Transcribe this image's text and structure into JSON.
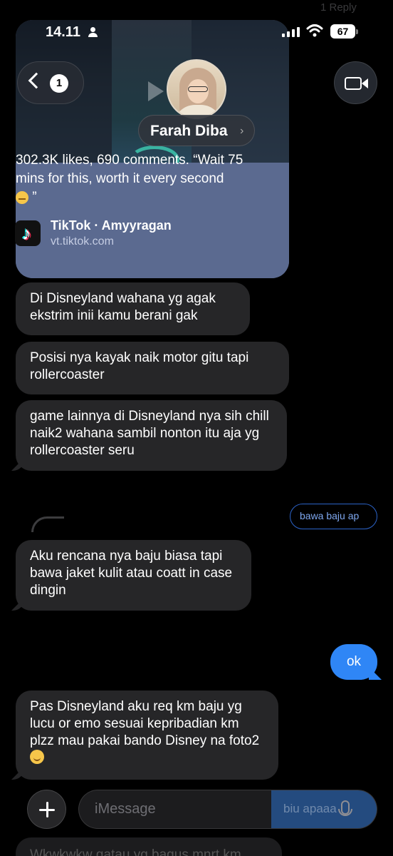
{
  "reply_hint": "1 Reply",
  "status_bar": {
    "time": "14.11",
    "battery": "67"
  },
  "header": {
    "back_count": "1",
    "contact_name": "Farah Diba",
    "contact_chevron": "›"
  },
  "link_preview": {
    "description": "302.3K likes, 690 comments. “Wait 75 mins for this, worth it every second",
    "description_end": "”",
    "source": "TikTok · Amyyragan",
    "url": "vt.tiktok.com",
    "logo_glyph": "♪"
  },
  "messages": [
    {
      "text": "Di Disneyland wahana yg agak ekstrim inii kamu berani gak"
    },
    {
      "text": "Posisi nya kayak naik motor gitu tapi rollercoaster"
    },
    {
      "text": "game lainnya di Disneyland nya sih chill naik2 wahana sambil nonton itu aja yg rollercoaster seru"
    },
    {
      "text": "bawa baju ap"
    },
    {
      "text": "Aku rencana nya baju biasa tapi bawa jaket kulit atau coatt in case dingin"
    },
    {
      "text": "ok"
    },
    {
      "text": "Pas Disneyland aku req km baju yg lucu or emo sesuai kepribadian km plzz mau pakai bando Disney na foto2"
    }
  ],
  "composer": {
    "placeholder": "iMessage",
    "behind_text": "biu apaaa"
  },
  "bottom_peek": "Wkwkwkw gatau yg bagus mnrt km",
  "colors": {
    "incoming": "#262628",
    "outgoing": "#2f86f6",
    "link_card": "#5b6a90"
  },
  "icons": [
    "person-icon",
    "signal-icon",
    "wifi-icon",
    "battery-icon",
    "chevron-left-icon",
    "video-camera-icon",
    "play-icon",
    "tiktok-icon",
    "smile-emoji-icon",
    "plus-icon",
    "mic-icon"
  ]
}
